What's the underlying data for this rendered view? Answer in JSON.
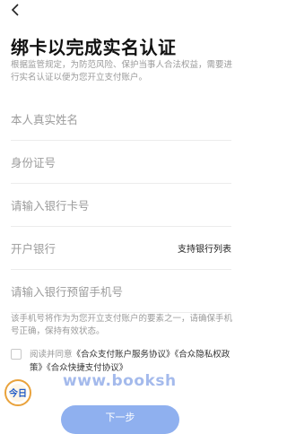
{
  "nav": {
    "back_icon": "chevron-left-icon"
  },
  "header": {
    "title": "绑卡以完成实名认证",
    "subtitle": "根据监管规定，为防范风险、保护当事人合法权益，需要进行实名认证以便为您开立支付账户。"
  },
  "form": {
    "name_placeholder": "本人真实姓名",
    "id_placeholder": "身份证号",
    "card_placeholder": "请输入银行卡号",
    "bank_label": "开户银行",
    "supported_banks_link": "支持银行列表",
    "phone_placeholder": "请输入银行预留手机号",
    "phone_note": "该手机号将作为为您开立支付账户的要素之一，请确保手机号正确，保持有效状态。"
  },
  "agreement": {
    "prefix": "阅读并同意",
    "docs": "《合众支付账户服务协议》《合众隐私权政策》《合众快捷支付协议》"
  },
  "footer": {
    "next_button": "下一步",
    "watermark": "www.booksh",
    "badge_text": "今日"
  },
  "colors": {
    "button": "#8fb0ef",
    "placeholder": "#9c9c9c"
  }
}
